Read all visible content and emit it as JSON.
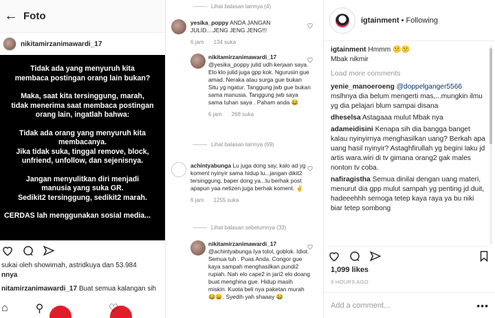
{
  "left": {
    "header_title": "Foto",
    "username": "nikitamirzanimawardi_17",
    "post_lines": [
      "Tidak ada yang menyuruh kita\nmembaca postingan orang lain bukan?",
      "Maka, saat kita tersinggung, marah,\ntidak menerima saat membaca postingan\norang lain, ingatlah bahwa:",
      "Tidak ada orang yang menyuruh kita\nmembacanya.\nJika tidak suka, tinggal remove, block,\nunfriend, unfollow, dan sejenisnya.",
      "Jangan menyulitkan diri menjadi\nmanusia yang suka GR.\nSedikit2 tersinggung, sedikit2 marah.",
      "CERDAS lah menggunakan sosial media..."
    ],
    "likes_text": "sukai oleh showimah, astridkuya dan 53.984",
    "likes_text2": "nnya",
    "caption_user": "nitamirzanimawardi_17",
    "caption_text": "Buat semua kalangan sih"
  },
  "mid": {
    "view_more_top": "Lihat balasan lainnya (4)",
    "c1": {
      "user": "yesika_poppy",
      "text": "ANDA JANGAN JULID....JENG JENG JENG!!!",
      "time": "6 jam",
      "likes": "134 suka"
    },
    "c2": {
      "user": "nikitamirzanimawardi_17",
      "text": "@yesika_poppy julid udh kerjaan saya. Elo klo julid juga gpp kok. Ngurusin gue amad. Neraka atau surga gue bukan Situ yg ngatur. Tanggung jwb gue bukan sama manusia. Tanggung jwb saya sama tuhan saya . Paham anda 😂",
      "time": "6 jam",
      "likes": "268 suka"
    },
    "view_more_69": "Lihat balasan lainnya (69)",
    "c3": {
      "user": "achintyabunga",
      "text": "Lu juga dong say, kalo ad yg koment nyinyir sama hidup lu...jangan dikit2 tersinggung, baper dong ya...lu berhak post apapun yaa netizen juga berhak koment. ✌",
      "time": "6 jam",
      "likes": "1255 suka"
    },
    "view_prev_33": "Lihat balasan sebelumnya (33)",
    "c4": {
      "user": "nikitamirzanimawardi_17",
      "text": "@achintyabunga Iya tolol, goblok. Idiot. Semua tuh . Puas Anda. Congor gue kaya sampah menghasilkan pundi2 rupiah. Nah elo cape2 in jari2 elo doang buat menghina gue. Hidup masih miskin. Kuota beli nya paketan murah 😂😄. Syedih yah shaaay 😂"
    }
  },
  "right": {
    "account": "igtainment",
    "separator": "•",
    "following": "Following",
    "caption_user": "igtainment",
    "caption_text": "Hmmm 😕😕",
    "caption_text2": "Mbak nikmir",
    "load_more": "Load more comments",
    "comments": [
      {
        "user": "yenie_manoeroeng",
        "mention": "@doppelganger5566",
        "text": "mslhnya dia belum mengerti mas,...mungkin ilmu yg dia pelajari blum sampai disana"
      },
      {
        "user": "dheselsa",
        "mention": "",
        "text": "Astagaaa mulut Mbak nya"
      },
      {
        "user": "adameidisini",
        "mention": "",
        "text": "Kenapa sih dia bangga banget kalau nyinyirnya menghasilkan uang? Berkah apa uang hasil nyinyir? Astaghfirullah yg begini laku jd artis wara.wiri di tv gimana orang2 gak males nonton tv coba."
      },
      {
        "user": "nafiragistha",
        "mention": "",
        "text": "Semua dinilai dengan uang materi, menurut dia gpp mulut sampah yg penting jd duit, hadeeehhh semoga tetep kaya raya ya bu niki biar tetep sombong"
      }
    ],
    "likes": "1,099 likes",
    "time": "9 HOURS AGO",
    "add_placeholder": "Add a comment...",
    "more_dots": "•••"
  }
}
